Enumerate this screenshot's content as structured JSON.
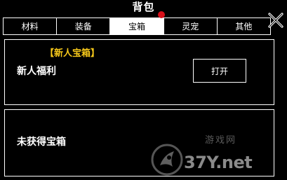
{
  "window": {
    "title": "背包"
  },
  "tabs": [
    {
      "label": "材料",
      "active": false
    },
    {
      "label": "装备",
      "active": false
    },
    {
      "label": "宝箱",
      "active": true
    },
    {
      "label": "灵宠",
      "active": false
    },
    {
      "label": "其他",
      "active": false
    }
  ],
  "chest_panel": {
    "tag": "【新人宝箱】",
    "name": "新人福利",
    "open_button_label": "打开"
  },
  "empty_panel": {
    "text": "未获得宝箱"
  },
  "watermark": {
    "top_text": "游戏网",
    "text": "37Y.net"
  },
  "colors": {
    "background": "#000000",
    "accent_gold": "#f5c71a",
    "badge_red": "#d8101a",
    "border": "#ffffff"
  },
  "icons": {
    "close": "close-x-icon",
    "badge": "notification-dot-icon"
  }
}
